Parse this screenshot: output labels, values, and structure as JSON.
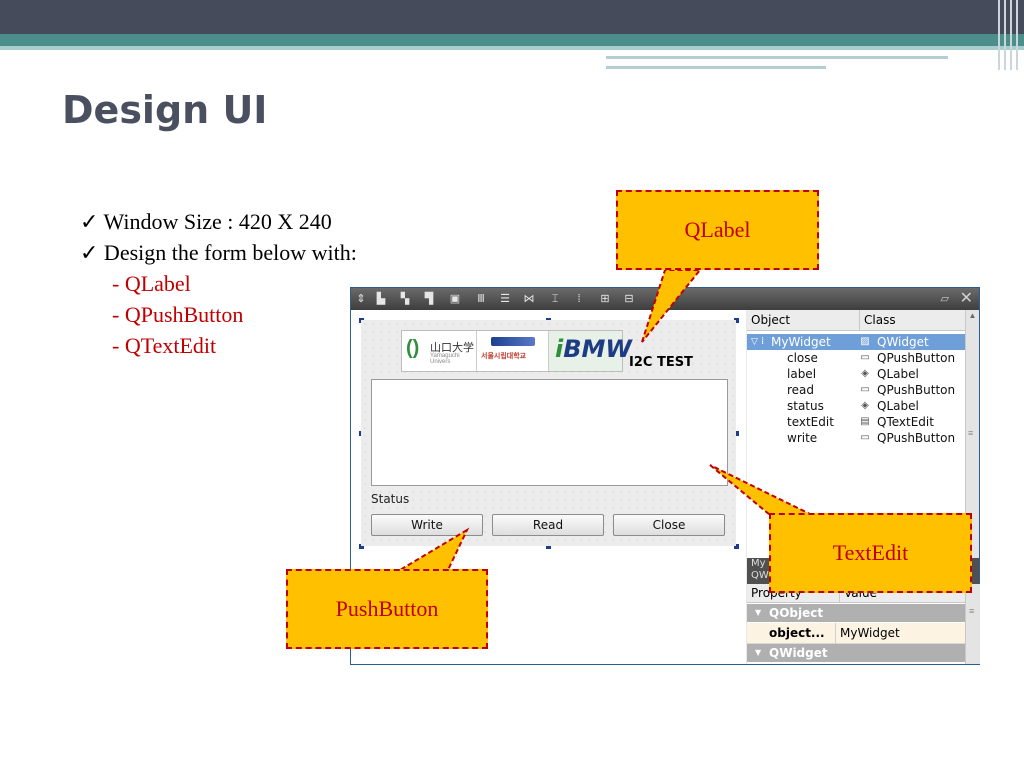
{
  "slide": {
    "title": "Design UI",
    "bullets": [
      "✓ Window Size : 420 X 240",
      "✓ Design the form below with:"
    ],
    "subitems": [
      "- QLabel",
      "- QPushButton",
      "- QTextEdit"
    ]
  },
  "designer": {
    "toolbar_icons": [
      "edit-signals-icon",
      "edit-buddies-icon",
      "edit-tab-order-icon",
      "edit-widgets-icon",
      "preview-icon",
      "layout-horizontal-icon",
      "layout-vertical-icon",
      "layout-splitter-h-icon",
      "layout-splitter-v-icon",
      "layout-grid-icon",
      "layout-form-icon",
      "break-layout-icon"
    ],
    "close_glyph": "✕",
    "form": {
      "title_label": "I2C TEST",
      "logos": {
        "yamaguchi_jp": "山口大学",
        "yamaguchi_en": "Yamaguchi Univers",
        "seoul_kr": "서울시립대학교",
        "bmw_i": "i",
        "bmw_text": "BMW"
      },
      "status_label": "Status",
      "buttons": {
        "write": "Write",
        "read": "Read",
        "close": "Close"
      }
    },
    "object_inspector": {
      "columns": {
        "object": "Object",
        "class": "Class"
      },
      "rows": [
        {
          "object": "MyWidget",
          "class": "QWidget",
          "selected": true
        },
        {
          "object": "close",
          "class": "QPushButton"
        },
        {
          "object": "label",
          "class": "QLabel"
        },
        {
          "object": "read",
          "class": "QPushButton"
        },
        {
          "object": "status",
          "class": "QLabel"
        },
        {
          "object": "textEdit",
          "class": "QTextEdit"
        },
        {
          "object": "write",
          "class": "QPushButton"
        }
      ]
    },
    "dock_title_line1": "My",
    "dock_title_line2": "QW",
    "property_editor": {
      "columns": {
        "property": "Property",
        "value": "Value"
      },
      "groups": {
        "qobject": "QObject",
        "qwidget": "QWidget"
      },
      "rows": [
        {
          "name": "object...",
          "value": "MyWidget"
        }
      ]
    }
  },
  "callouts": {
    "qlabel": "QLabel",
    "textedit": "TextEdit",
    "pushbutton": "PushButton"
  },
  "colors": {
    "callout_fill": "#ffc000",
    "callout_text": "#c00000",
    "title_text": "#4a5060",
    "selection": "#6f9fd8"
  }
}
